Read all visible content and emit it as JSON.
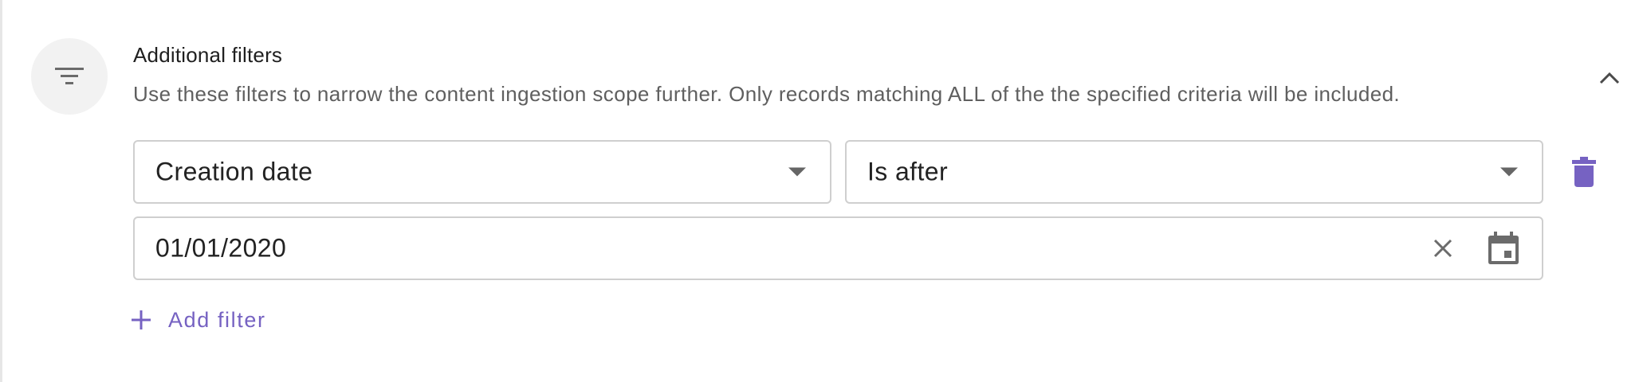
{
  "section": {
    "title": "Additional filters",
    "description": "Use these filters to narrow the content ingestion scope further. Only records matching ALL of the the specified criteria will be included.",
    "icon": "filter-icon",
    "collapse_icon": "chevron-up-icon"
  },
  "filter": {
    "field_value": "Creation date",
    "operator_value": "Is after",
    "date_value": "01/01/2020",
    "delete_icon": "trash-icon",
    "clear_icon": "close-icon",
    "calendar_icon": "calendar-icon"
  },
  "add_filter": {
    "label": "Add filter",
    "icon": "plus-icon"
  },
  "colors": {
    "accent": "#7662c2",
    "border": "#cfcfcf",
    "avatar_bg": "#f2f2f2",
    "text_primary": "#1f1f1f",
    "text_secondary": "#5f5f5f"
  }
}
